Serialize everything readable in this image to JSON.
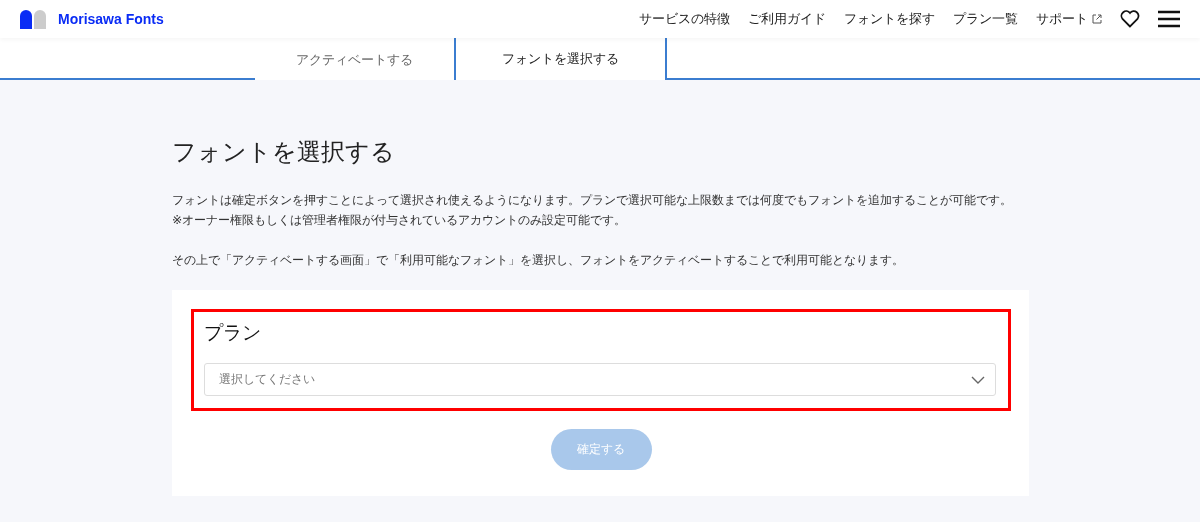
{
  "header": {
    "logo_text": "Morisawa Fonts",
    "nav": [
      {
        "label": "サービスの特徴",
        "external": false
      },
      {
        "label": "ご利用ガイド",
        "external": false
      },
      {
        "label": "フォントを探す",
        "external": false
      },
      {
        "label": "プラン一覧",
        "external": false
      },
      {
        "label": "サポート",
        "external": true
      }
    ]
  },
  "tabs": [
    {
      "label": "アクティベートする",
      "selected": false
    },
    {
      "label": "フォントを選択する",
      "selected": true
    }
  ],
  "page_title": "フォントを選択する",
  "paragraphs": [
    [
      "フォントは確定ボタンを押すことによって選択され使えるようになります。プランで選択可能な上限数までは何度でもフォントを追加することが可能です。",
      "※オーナー権限もしくは管理者権限が付与されているアカウントのみ設定可能です。"
    ],
    [
      "その上で「アクティベートする画面」で「利用可能なフォント」を選択し、フォントをアクティベートすることで利用可能となります。"
    ]
  ],
  "plan_section": {
    "highlighted": true,
    "label": "プラン",
    "select": {
      "placeholder": "選択してください"
    }
  },
  "confirm_button": {
    "label": "確定する",
    "disabled": true
  }
}
